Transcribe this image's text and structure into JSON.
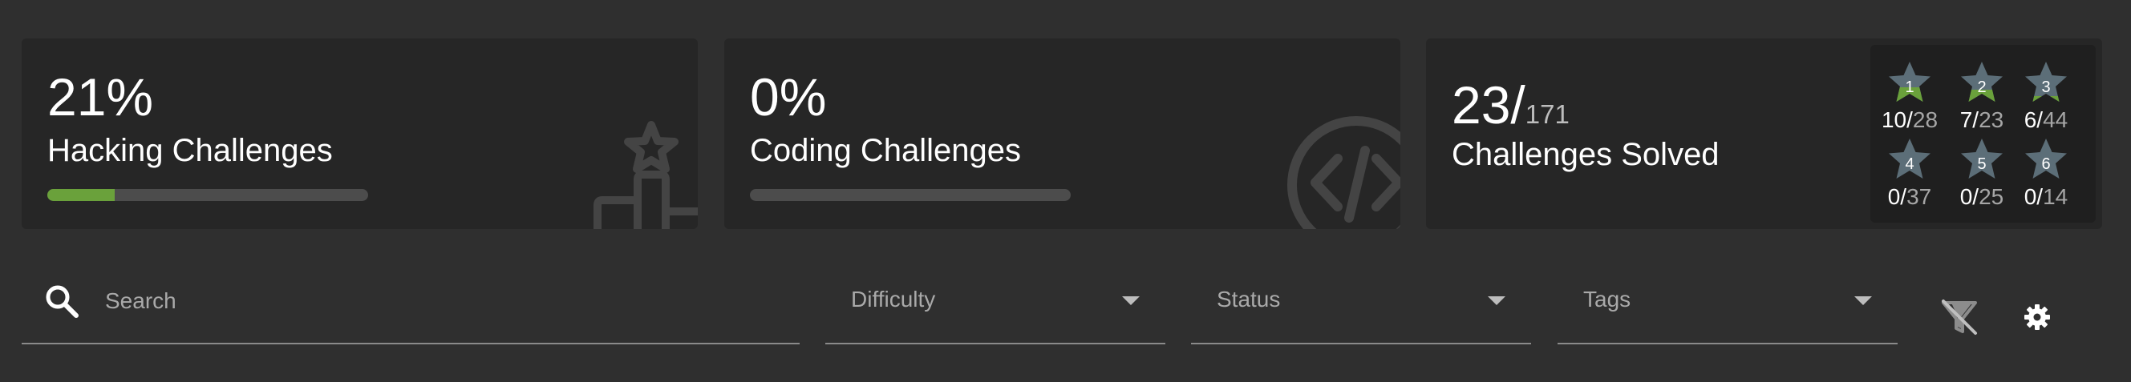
{
  "hacking": {
    "percent": "21%",
    "title": "Hacking Challenges",
    "progress": 0.21,
    "icon": "podium-star-icon"
  },
  "coding": {
    "percent": "0%",
    "title": "Coding Challenges",
    "progress": 0,
    "icon": "code-icon"
  },
  "solved": {
    "count": "23/",
    "total": "171",
    "title": "Challenges Solved",
    "stars": [
      {
        "level": "1",
        "solved": "10/",
        "total": "28",
        "fill": 0.36
      },
      {
        "level": "2",
        "solved": "7/",
        "total": "23",
        "fill": 0.3
      },
      {
        "level": "3",
        "solved": "6/",
        "total": "44",
        "fill": 0.14
      },
      {
        "level": "4",
        "solved": "0/",
        "total": "37",
        "fill": 0
      },
      {
        "level": "5",
        "solved": "0/",
        "total": "25",
        "fill": 0
      },
      {
        "level": "6",
        "solved": "0/",
        "total": "14",
        "fill": 0
      }
    ]
  },
  "filters": {
    "search_placeholder": "Search",
    "difficulty_label": "Difficulty",
    "status_label": "Status",
    "tags_label": "Tags"
  },
  "icons": {
    "search": "search-icon",
    "clear_filter": "filter-off-icon",
    "settings": "gear-icon",
    "dropdown": "chevron-down-icon"
  },
  "colors": {
    "background": "#2f2f2f",
    "card": "#262626",
    "accent_green": "#6aa13b",
    "star_gray": "#5c6e78",
    "track": "#4c4c4c"
  }
}
